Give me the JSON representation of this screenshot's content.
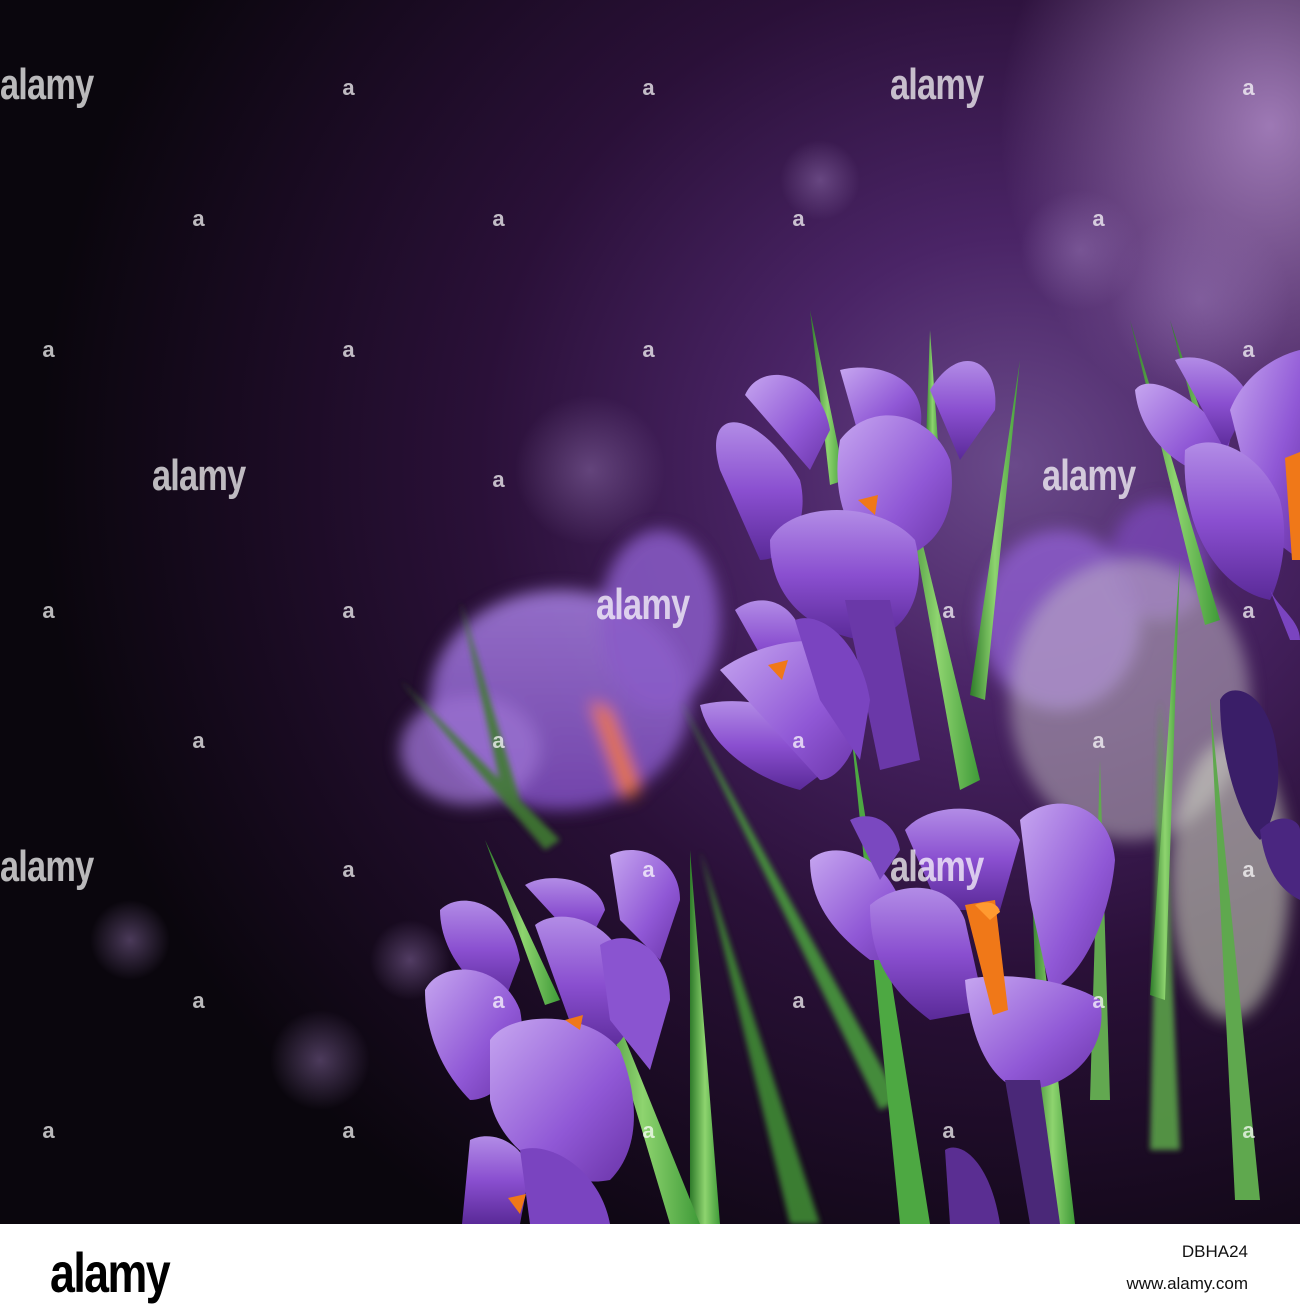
{
  "image": {
    "subject": "purple crocus flowers with green leaves on a dark bokeh background",
    "colors": {
      "background_dark": "#0c0710",
      "background_purple": "#3a1850",
      "petal": "#8a4fd0",
      "petal_light": "#b28ce6",
      "petal_dark": "#5a2a98",
      "stamen": "#f07818",
      "leaf": "#3f9a38",
      "leaf_light": "#8ed46f"
    }
  },
  "watermarks": {
    "brand": "alamy",
    "mark": "a"
  },
  "footer": {
    "logo": "alamy",
    "image_id": "DBHA24",
    "site": "www.alamy.com"
  }
}
